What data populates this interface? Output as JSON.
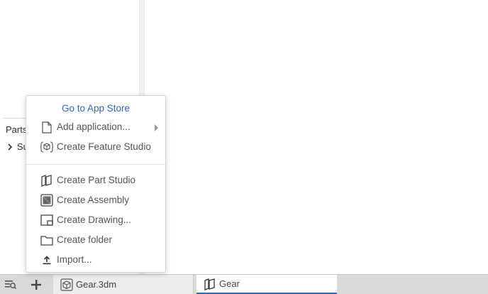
{
  "left_panel": {
    "parts_header": "Parts",
    "parts_row_label": "Su"
  },
  "menu": {
    "app_store": "Go to App Store",
    "add_application": "Add application...",
    "create_feature_studio": "Create Feature Studio",
    "create_part_studio": "Create Part Studio",
    "create_assembly": "Create Assembly",
    "create_drawing": "Create Drawing...",
    "create_folder": "Create folder",
    "import": "Import..."
  },
  "tabs": [
    {
      "label": "Gear.3dm",
      "icon": "cube-icon",
      "active": false
    },
    {
      "label": "Gear",
      "icon": "part-studio-icon",
      "active": true
    }
  ],
  "colors": {
    "accent": "#2e6bbf",
    "tabbar": "#d9d9d9"
  }
}
